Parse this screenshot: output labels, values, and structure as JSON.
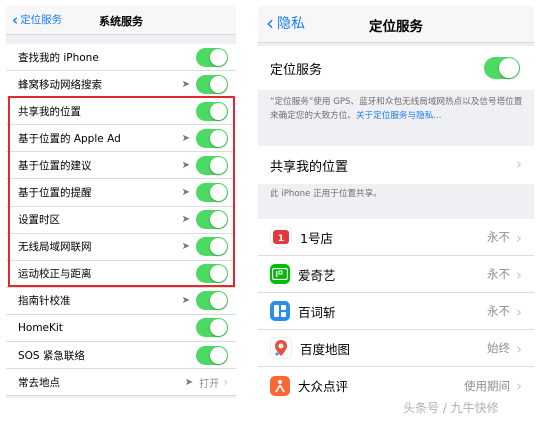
{
  "left": {
    "back_label": "定位服务",
    "title": "系统服务",
    "rows": [
      {
        "label": "查找我的 iPhone",
        "arrow": false,
        "toggle": true,
        "value": ""
      },
      {
        "label": "蜂窝移动网络搜索",
        "arrow": true,
        "toggle": true,
        "value": ""
      },
      {
        "label": "共享我的位置",
        "arrow": false,
        "toggle": true,
        "value": ""
      },
      {
        "label": "基于位置的 Apple Ad",
        "arrow": true,
        "toggle": true,
        "value": ""
      },
      {
        "label": "基于位置的建议",
        "arrow": true,
        "toggle": true,
        "value": ""
      },
      {
        "label": "基于位置的提醒",
        "arrow": true,
        "toggle": true,
        "value": ""
      },
      {
        "label": "设置时区",
        "arrow": true,
        "toggle": true,
        "value": ""
      },
      {
        "label": "无线局域网联网",
        "arrow": true,
        "toggle": true,
        "value": ""
      },
      {
        "label": "运动校正与距离",
        "arrow": false,
        "toggle": true,
        "value": ""
      },
      {
        "label": "指南针校准",
        "arrow": true,
        "toggle": true,
        "value": ""
      },
      {
        "label": "HomeKit",
        "arrow": false,
        "toggle": true,
        "value": ""
      },
      {
        "label": "SOS 紧急联络",
        "arrow": false,
        "toggle": true,
        "value": ""
      },
      {
        "label": "常去地点",
        "arrow": true,
        "toggle": false,
        "value": "打开"
      }
    ]
  },
  "right": {
    "back_label": "隐私",
    "title": "定位服务",
    "location_services_label": "定位服务",
    "description": "“定位服务”使用 GPS、蓝牙和众包无线局域网热点以及信号塔位置来确定您的大致方位。",
    "description_link": "关于定位服务与隐私...",
    "share_location_label": "共享我的位置",
    "share_location_desc": "此 iPhone 正用于位置共享。",
    "apps": [
      {
        "name": "1号店",
        "value": "永不",
        "icon": "yhd-icon",
        "color": "#ffffff"
      },
      {
        "name": "爱奇艺",
        "value": "永不",
        "icon": "iqiyi-icon",
        "color": "#00be06"
      },
      {
        "name": "百词斩",
        "value": "永不",
        "icon": "baicizhan-icon",
        "color": "#2b8ee8"
      },
      {
        "name": "百度地图",
        "value": "始终",
        "icon": "baidu-map-icon",
        "color": "#ffffff"
      },
      {
        "name": "大众点评",
        "value": "使用期间",
        "icon": "dianping-icon",
        "color": "#ff6633"
      }
    ]
  },
  "watermark": "头条号 / 九牛快修",
  "colors": {
    "accent": "#1a7cf5",
    "toggle_on": "#4cd964",
    "highlight": "#e0282e"
  }
}
